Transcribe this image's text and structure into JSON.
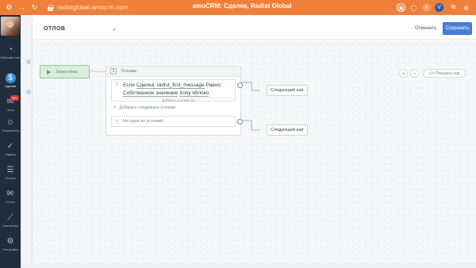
{
  "browser": {
    "url": "radistglobal.amocrm.com",
    "window_title": "amoCRM: Сделки, Radist Global",
    "accent_color": "#ef7f3a"
  },
  "sidebar": {
    "items": [
      {
        "label": "Рабочий стол",
        "icon": "speedometer-icon"
      },
      {
        "label": "Сделки",
        "icon": "deals-icon",
        "active": true
      },
      {
        "label": "Чаты",
        "icon": "chat-icon",
        "badge": "99+"
      },
      {
        "label": "Покупатели",
        "icon": "customers-icon"
      },
      {
        "label": "Задачи",
        "icon": "tasks-icon"
      },
      {
        "label": "Списки",
        "icon": "lists-icon"
      },
      {
        "label": "Почта",
        "icon": "mail-icon"
      },
      {
        "label": "Аналитика",
        "icon": "analytics-icon"
      },
      {
        "label": "Настройки",
        "icon": "settings-icon"
      }
    ]
  },
  "header": {
    "select_value": "ОТЛОВ",
    "cancel_label": "Отменить",
    "save_label": "Сохранить"
  },
  "toolbar": {
    "zoom_in": "+",
    "zoom_out": "−",
    "show_code_label": "</> Показать код"
  },
  "flow": {
    "start_label": "Запуск бота",
    "condition": {
      "number": "1",
      "title": "Условие",
      "rule1": {
        "prefix": "Если",
        "field": "Сделка: radist_first_message",
        "operator": "Равно:",
        "value_label": "Собственное значение",
        "value": "Хочу яблоко",
        "add_inner": "Добавить условие (и)"
      },
      "add_next_label": "Добавить следующее условие",
      "rule2_label": "Ни одна из условий"
    },
    "next_step_1": "Следующий шаг",
    "next_step_2": "Следующий шаг"
  }
}
